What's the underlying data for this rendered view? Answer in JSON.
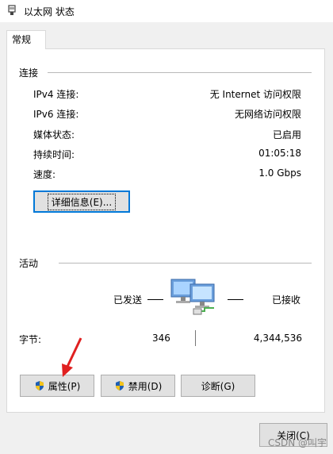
{
  "window": {
    "title": "以太网 状态"
  },
  "tab": {
    "label": "常规"
  },
  "connection": {
    "title": "连接",
    "rows": [
      {
        "label": "IPv4 连接:",
        "value": "无 Internet 访问权限"
      },
      {
        "label": "IPv6 连接:",
        "value": "无网络访问权限"
      },
      {
        "label": "媒体状态:",
        "value": "已启用"
      },
      {
        "label": "持续时间:",
        "value": "01:05:18"
      },
      {
        "label": "速度:",
        "value": "1.0 Gbps"
      }
    ],
    "details_button": "详细信息(E)..."
  },
  "activity": {
    "title": "活动",
    "sent_label": "已发送",
    "received_label": "已接收",
    "bytes_label": "字节:",
    "bytes_sent": "346",
    "bytes_received": "4,344,536"
  },
  "buttons": {
    "properties": "属性(P)",
    "disable": "禁用(D)",
    "diagnose": "诊断(G)",
    "close": "关闭(C)"
  },
  "watermark": "CSDN @叫宇",
  "colors": {
    "focus_border": "#0078d7",
    "annotation_arrow": "#e02020"
  },
  "icons": [
    "network-adapter-icon",
    "network-computers-icon",
    "shield-icon"
  ]
}
